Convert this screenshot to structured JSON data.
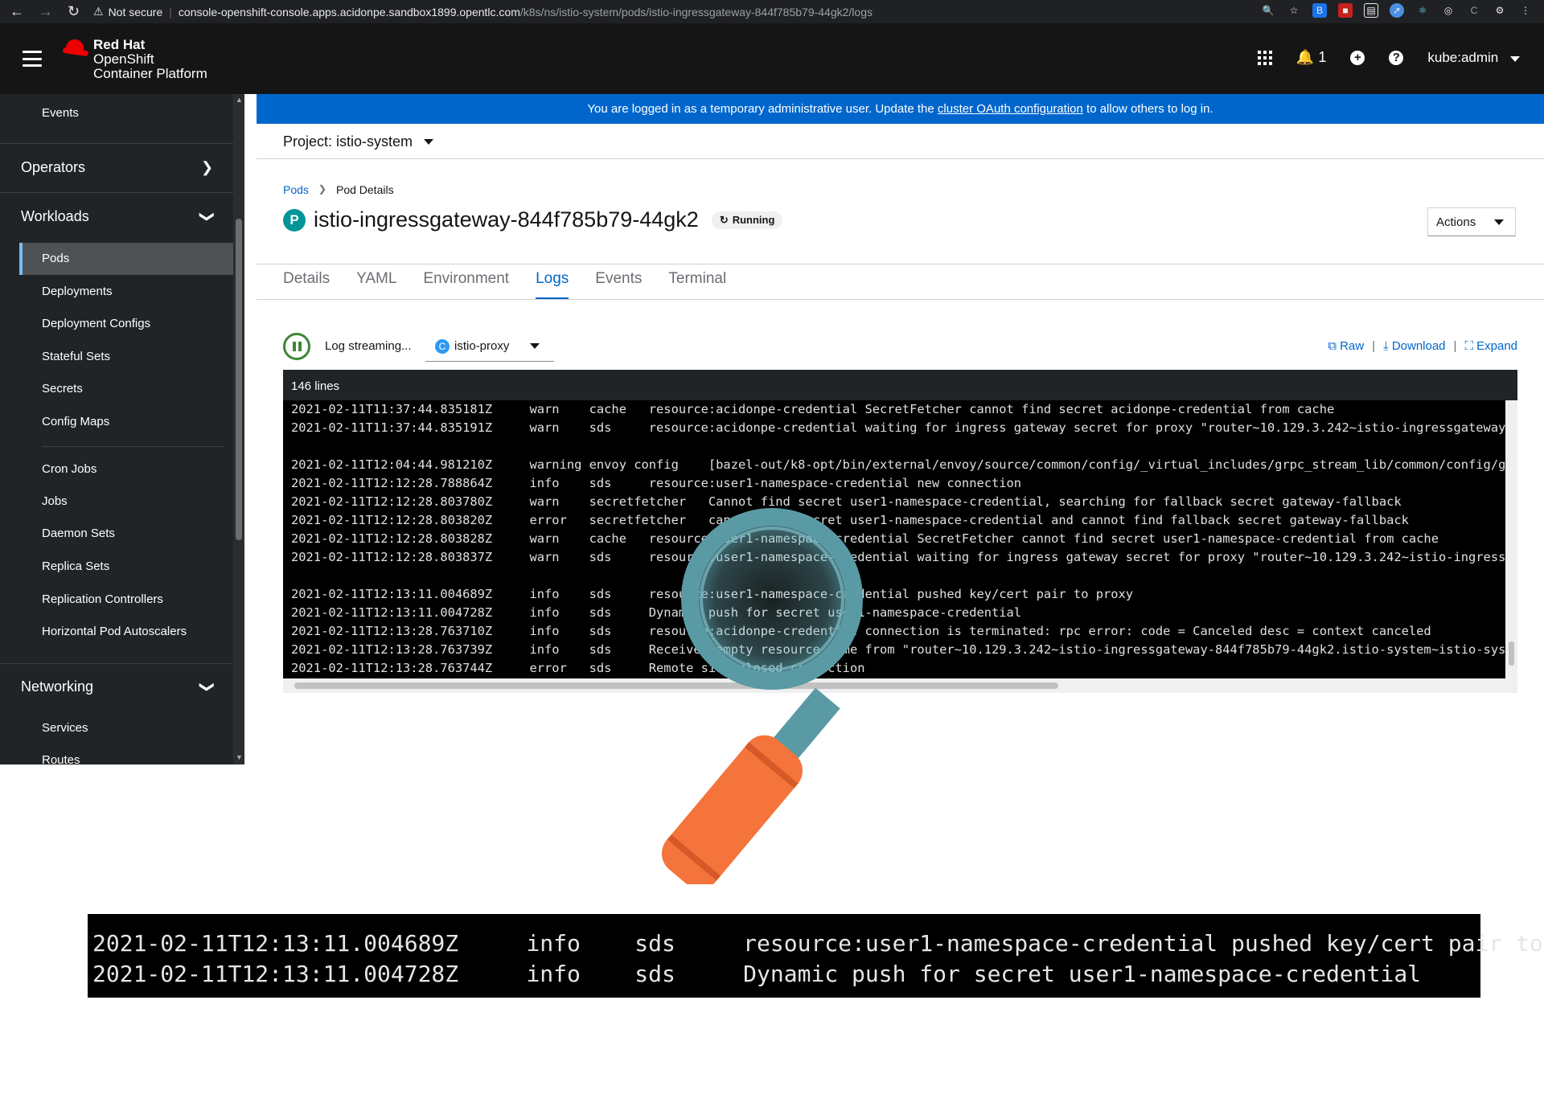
{
  "browser": {
    "security": "Not secure",
    "url_host": "console-openshift-console.apps.acidonpe.sandbox1899.opentlc.com",
    "url_path": "/k8s/ns/istio-system/pods/istio-ingressgateway-844f785b79-44gk2/logs"
  },
  "masthead": {
    "brand_line1": "Red Hat",
    "brand_line2": "OpenShift",
    "brand_line3": "Container Platform",
    "notifications_count": "1",
    "user": "kube:admin"
  },
  "sidebar": {
    "events": "Events",
    "operators": "Operators",
    "workloads": "Workloads",
    "workload_items": [
      "Pods",
      "Deployments",
      "Deployment Configs",
      "Stateful Sets",
      "Secrets",
      "Config Maps",
      "Cron Jobs",
      "Jobs",
      "Daemon Sets",
      "Replica Sets",
      "Replication Controllers",
      "Horizontal Pod Autoscalers"
    ],
    "networking": "Networking",
    "networking_items": [
      "Services",
      "Routes"
    ]
  },
  "banner": {
    "text_before": "You are logged in as a temporary administrative user. Update the",
    "link": "cluster OAuth configuration",
    "text_after": "to allow others to log in."
  },
  "project": "Project: istio-system",
  "breadcrumb": {
    "pods": "Pods",
    "current": "Pod Details"
  },
  "pod": {
    "badge": "P",
    "name": "istio-ingressgateway-844f785b79-44gk2",
    "status": "Running"
  },
  "actions_label": "Actions",
  "tabs": [
    "Details",
    "YAML",
    "Environment",
    "Logs",
    "Events",
    "Terminal"
  ],
  "logs": {
    "streaming": "Log streaming...",
    "container_badge": "C",
    "container": "istio-proxy",
    "raw": "Raw",
    "download": "Download",
    "expand": "Expand",
    "line_count": "146 lines",
    "lines": [
      "2021-02-11T11:37:44.835181Z     warn    cache   resource:acidonpe-credential SecretFetcher cannot find secret acidonpe-credential from cache",
      "2021-02-11T11:37:44.835191Z     warn    sds     resource:acidonpe-credential waiting for ingress gateway secret for proxy \"router~10.129.3.242~istio-ingressgateway",
      "",
      "2021-02-11T12:04:44.981210Z     warning envoy config    [bazel-out/k8-opt/bin/external/envoy/source/common/config/_virtual_includes/grpc_stream_lib/common/config/g",
      "2021-02-11T12:12:28.788864Z     info    sds     resource:user1-namespace-credential new connection",
      "2021-02-11T12:12:28.803780Z     warn    secretfetcher   Cannot find secret user1-namespace-credential, searching for fallback secret gateway-fallback",
      "2021-02-11T12:12:28.803820Z     error   secretfetcher   cannot find secret user1-namespace-credential and cannot find fallback secret gateway-fallback",
      "2021-02-11T12:12:28.803828Z     warn    cache   resource:user1-namespace-credential SecretFetcher cannot find secret user1-namespace-credential from cache",
      "2021-02-11T12:12:28.803837Z     warn    sds     resource:user1-namespace-credential waiting for ingress gateway secret for proxy \"router~10.129.3.242~istio-ingress",
      "",
      "2021-02-11T12:13:11.004689Z     info    sds     resource:user1-namespace-credential pushed key/cert pair to proxy",
      "2021-02-11T12:13:11.004728Z     info    sds     Dynamic push for secret user1-namespace-credential",
      "2021-02-11T12:13:28.763710Z     info    sds     resource:acidonpe-credential connection is terminated: rpc error: code = Canceled desc = context canceled",
      "2021-02-11T12:13:28.763739Z     info    sds     Received empty resource name from \"router~10.129.3.242~istio-ingressgateway-844f785b79-44gk2.istio-system~istio-sys",
      "2021-02-11T12:13:28.763744Z     error   sds     Remote side closed connection"
    ]
  },
  "zoom": {
    "lines": [
      "2021-02-11T12:13:11.004689Z     info    sds     resource:user1-namespace-credential pushed key/cert pair to proxy",
      "2021-02-11T12:13:11.004728Z     info    sds     Dynamic push for secret user1-namespace-credential"
    ]
  },
  "colors": {
    "masthead": "#151515",
    "sidebar": "#212427",
    "banner": "#0066cc",
    "link": "#0066cc",
    "running_green": "#3e8635",
    "pod_badge": "#009596",
    "magnifier_ring": "#5a9aa5",
    "magnifier_handle": "#f4743b"
  }
}
